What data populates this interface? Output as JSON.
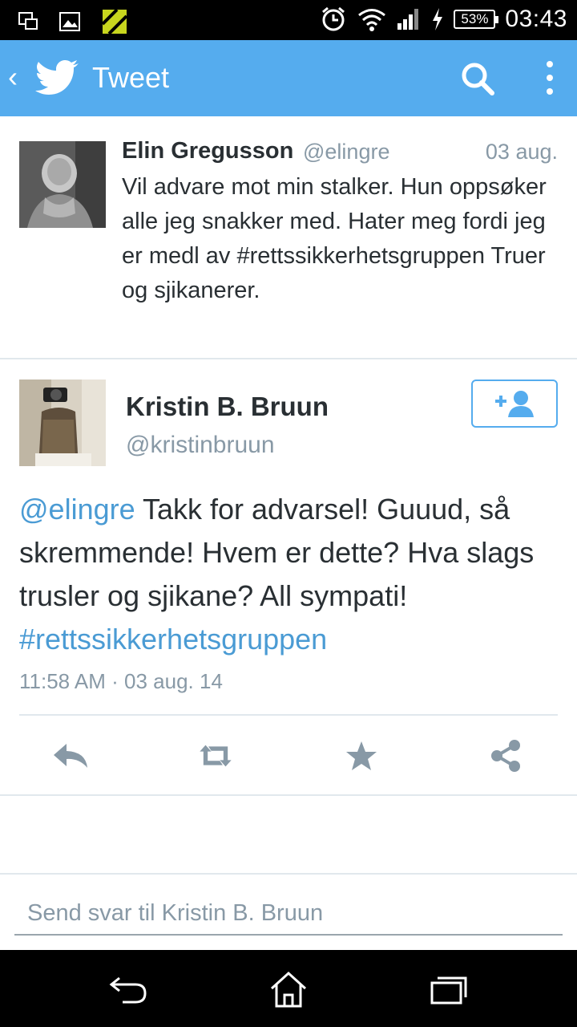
{
  "status_bar": {
    "battery": "53%",
    "time": "03:43"
  },
  "app_bar": {
    "title": "Tweet"
  },
  "tweets": [
    {
      "name": "Elin Gregusson",
      "handle": "@elingre",
      "date": "03 aug.",
      "text": "Vil advare mot min stalker. Hun oppsøker alle jeg snakker med. Hater meg fordi jeg er medl av #rettssikkerhetsgruppen Truer og sjikanerer."
    }
  ],
  "main_tweet": {
    "name": "Kristin B. Bruun",
    "handle": "@kristinbruun",
    "mention": "@elingre",
    "text": " Takk for advarsel! Guuud, så skremmende! Hvem er dette? Hva slags trusler og sjikane? All sympati! ",
    "hashtag": "#rettssikkerhetsgruppen",
    "timestamp": "11:58 AM · 03 aug. 14"
  },
  "reply": {
    "placeholder": "Send svar til Kristin B. Bruun"
  },
  "colors": {
    "brand": "#55acee",
    "link": "#4a9bd4",
    "icon": "#8899a6"
  }
}
